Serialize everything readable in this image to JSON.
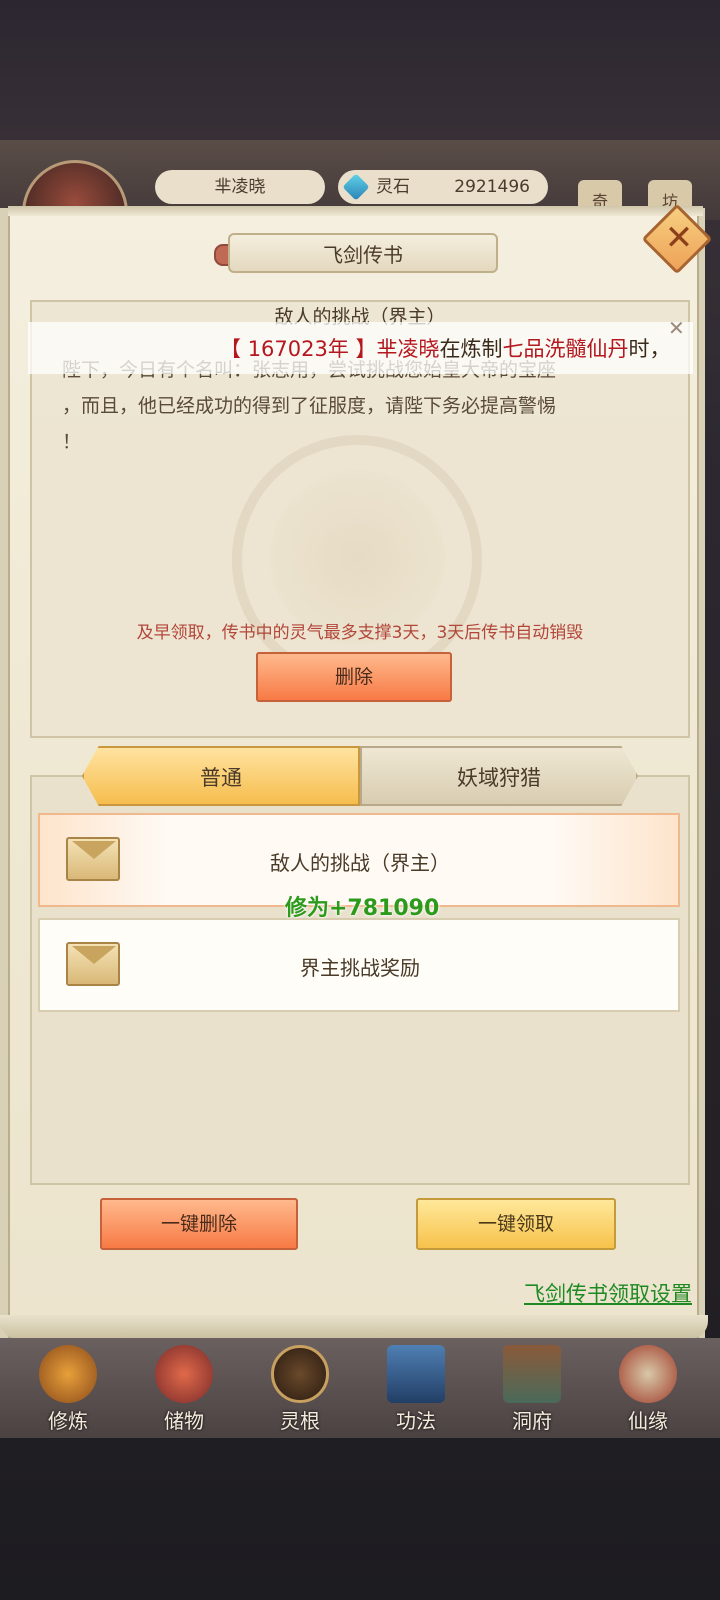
{
  "header": {
    "player_name": "芈凌晓",
    "currency_label": "灵石",
    "currency_value": "2921496",
    "mini_buttons": [
      "奇",
      "坊"
    ]
  },
  "modal": {
    "title": "飞剑传书",
    "message": {
      "title": "敌人的挑战（界主）",
      "body_line1": "陛下，今日有个名叫：张志用，尝试挑战您始皇大帝的宝座",
      "body_line2": "，而且，他已经成功的得到了征服度，请陛下务必提高警惕",
      "body_line3": "！",
      "warning": "及早领取，传书中的灵气最多支撑3天，3天后传书自动销毁",
      "delete_button": "删除"
    },
    "notification": {
      "prefix": "【 ",
      "year": "167023年",
      "mid1": " 】",
      "name": "芈凌晓",
      "mid2": "在炼制",
      "item": "七品洗髓仙丹",
      "suffix": "时，"
    },
    "tabs": [
      {
        "label": "普通",
        "active": true
      },
      {
        "label": "妖域狩猎",
        "active": false
      }
    ],
    "mails": [
      {
        "label": "敌人的挑战（界主）",
        "selected": true
      },
      {
        "label": "界主挑战奖励",
        "selected": false
      }
    ],
    "float_text": "修为+781090",
    "delete_all_button": "一键删除",
    "claim_all_button": "一键领取",
    "settings_link": "飞剑传书领取设置"
  },
  "bottom_nav": [
    {
      "label": "修炼",
      "icon": "cultivation-icon"
    },
    {
      "label": "储物",
      "icon": "storage-bag-icon"
    },
    {
      "label": "灵根",
      "icon": "spirit-root-icon"
    },
    {
      "label": "功法",
      "icon": "book-icon"
    },
    {
      "label": "洞府",
      "icon": "cave-residence-icon"
    },
    {
      "label": "仙缘",
      "icon": "fate-icon"
    }
  ]
}
